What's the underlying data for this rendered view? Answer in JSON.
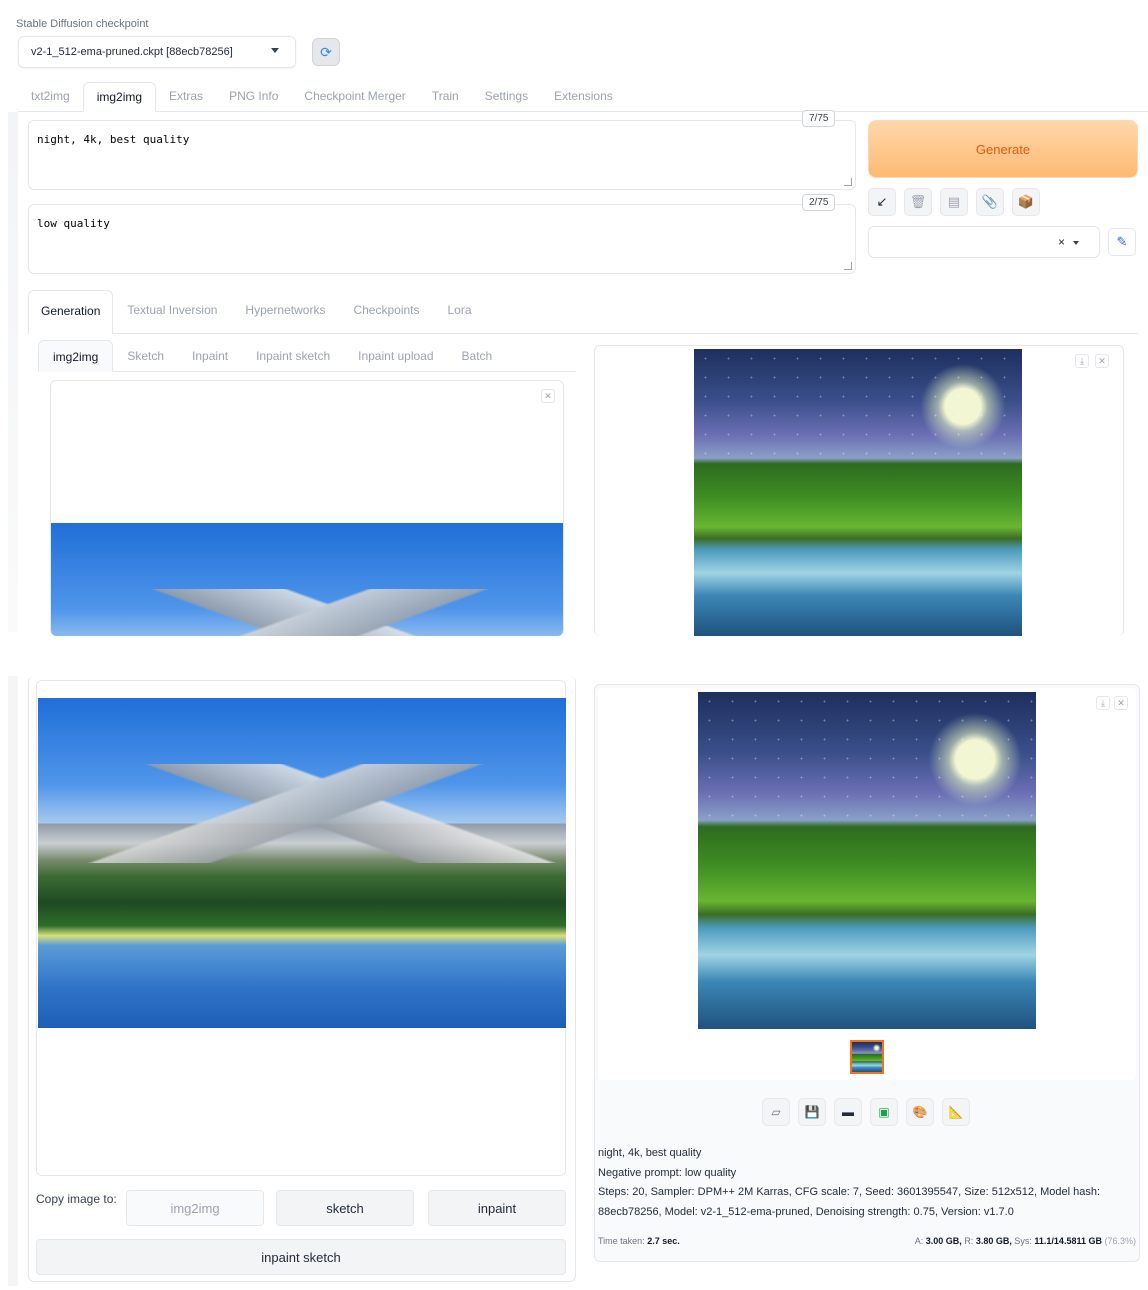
{
  "checkpoint": {
    "label": "Stable Diffusion checkpoint",
    "value": "v2-1_512-ema-pruned.ckpt [88ecb78256]"
  },
  "main_tabs": [
    "txt2img",
    "img2img",
    "Extras",
    "PNG Info",
    "Checkpoint Merger",
    "Train",
    "Settings",
    "Extensions"
  ],
  "active_main_tab": "img2img",
  "prompt": {
    "value": "night, 4k, best quality",
    "counter": "7/75"
  },
  "negative_prompt": {
    "value": "low quality",
    "counter": "2/75"
  },
  "generate_label": "Generate",
  "tool_icons": [
    "arrow-icon",
    "trash-icon",
    "clipboard-icon",
    "paperclip-icon",
    "box-icon"
  ],
  "styles": {
    "clear": "×"
  },
  "extra_tabs": [
    "Generation",
    "Textual Inversion",
    "Hypernetworks",
    "Checkpoints",
    "Lora"
  ],
  "mode_tabs": [
    "img2img",
    "Sketch",
    "Inpaint",
    "Inpaint sketch",
    "Inpaint upload",
    "Batch"
  ],
  "copy_image": {
    "label": "Copy image to:",
    "buttons": [
      "img2img",
      "sketch",
      "inpaint"
    ],
    "wide_button": "inpaint sketch"
  },
  "output": {
    "info_prompt": "night, 4k, best quality",
    "info_negative": "Negative prompt: low quality",
    "info_params_1": "Steps: 20, Sampler: DPM++ 2M Karras, CFG scale: 7, Seed: 3601395547, Size: 512x512, Model hash:",
    "info_params_2": "88ecb78256, Model: v2-1_512-ema-pruned, Denoising strength: 0.75, Version: v1.7.0",
    "time_label": "Time taken:",
    "time_value": "2.7 sec.",
    "vram_a_label": "A:",
    "vram_a": "3.00 GB,",
    "vram_r_label": "R:",
    "vram_r": "3.80 GB,",
    "vram_sys_label": "Sys:",
    "vram_sys": "11.1/14.5811 GB",
    "vram_pct": "(76.3%)"
  },
  "colors": {
    "generate_bg": "#fdba74",
    "generate_text": "#ea580c",
    "accent": "#f97316"
  }
}
